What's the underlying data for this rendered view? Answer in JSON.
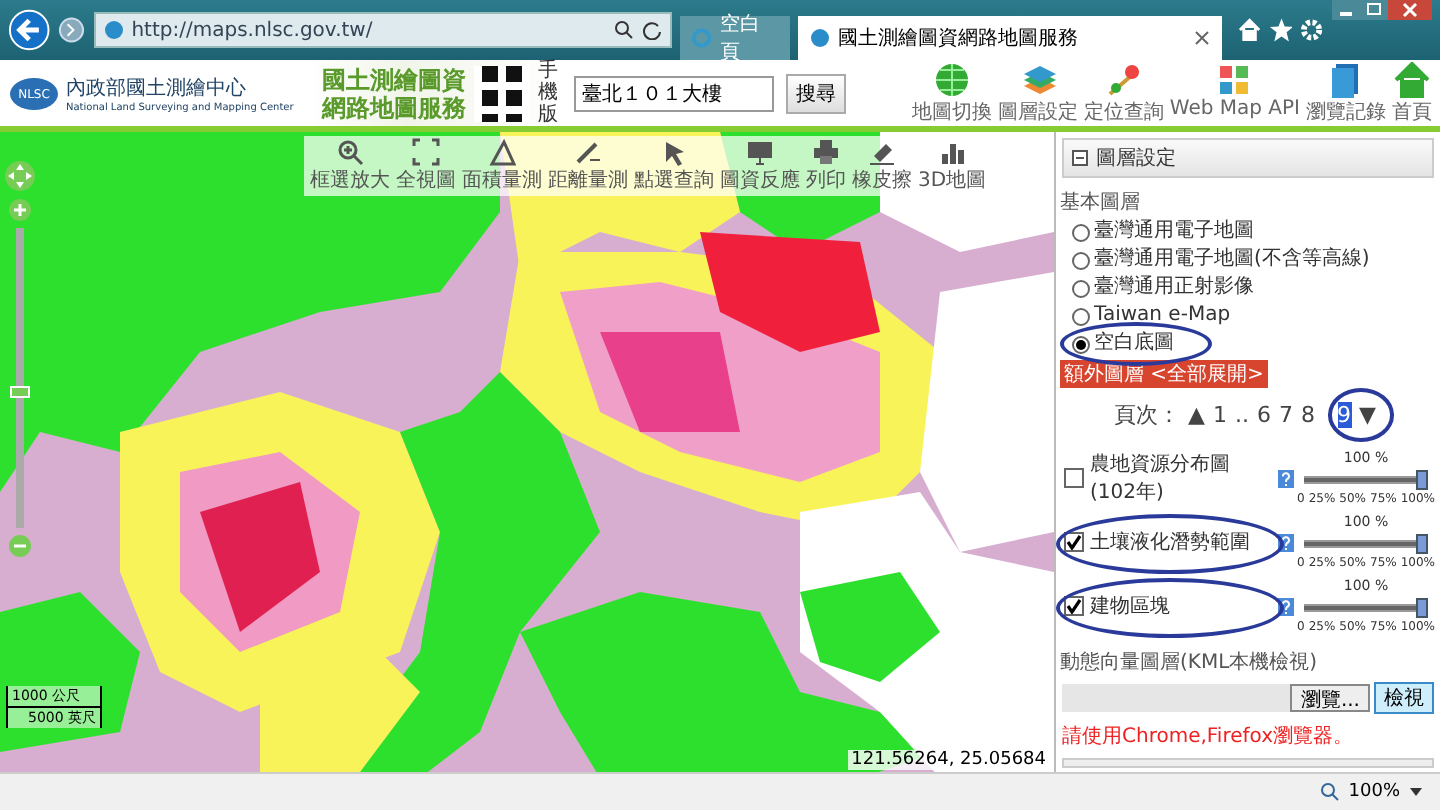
{
  "browser": {
    "address": "http://maps.nlsc.gov.tw/",
    "tabs": [
      {
        "label": "空白頁",
        "selected": false
      },
      {
        "label": "國土測繪圖資網路地圖服務",
        "selected": true
      }
    ]
  },
  "header": {
    "org_name": "內政部國土測繪中心",
    "org_name_en": "National Land Surveying and Mapping Center",
    "logo_text": "NLSC",
    "site_title": [
      "國土測繪圖資",
      "網路地圖服務"
    ],
    "mobile_label": "手機版",
    "search": {
      "value": "臺北１０１大樓"
    },
    "search_button": "搜尋",
    "nav": [
      {
        "label": "地圖切換",
        "kind": "globe"
      },
      {
        "label": "圖層設定",
        "kind": "layers"
      },
      {
        "label": "定位查詢",
        "kind": "pin"
      },
      {
        "label": "Web Map API",
        "kind": "api"
      },
      {
        "label": "瀏覽記錄",
        "kind": "record"
      },
      {
        "label": "首頁",
        "kind": "home"
      }
    ]
  },
  "map": {
    "toolbar": [
      {
        "label": "框選放大",
        "kind": "zoom"
      },
      {
        "label": "全視圖",
        "kind": "full"
      },
      {
        "label": "面積量測",
        "kind": "area"
      },
      {
        "label": "距離量測",
        "kind": "distance"
      },
      {
        "label": "點選查詢",
        "kind": "query"
      },
      {
        "label": "圖資反應",
        "kind": "feedback"
      },
      {
        "label": "列印",
        "kind": "print"
      },
      {
        "label": "橡皮擦",
        "kind": "eraser"
      },
      {
        "label": "3D地圖",
        "kind": "threed"
      }
    ],
    "zoom_slider": {
      "level": 0.45
    },
    "scale": [
      "1000 公尺",
      "5000 英尺"
    ],
    "coordinates": "121.56264, 25.05684"
  },
  "panel": {
    "title": "圖層設定",
    "base_title": "基本圖層",
    "base_layers": [
      {
        "label": "臺灣通用電子地圖",
        "selected": false,
        "circled": false
      },
      {
        "label": "臺灣通用電子地圖(不含等高線)",
        "selected": false,
        "circled": false
      },
      {
        "label": "臺灣通用正射影像",
        "selected": false,
        "circled": false
      },
      {
        "label": "Taiwan e-Map",
        "selected": false,
        "circled": false
      },
      {
        "label": "空白底圖",
        "selected": true,
        "circled": true
      }
    ],
    "extra_title": "額外圖層 <全部展開>",
    "pagination": {
      "label": "頁次：",
      "prev": "▲",
      "next": "▼",
      "circled": true,
      "pages": [
        {
          "label": "1",
          "selected": false
        },
        {
          "label": "..",
          "selected": false
        },
        {
          "label": "6",
          "selected": false
        },
        {
          "label": "7",
          "selected": false
        },
        {
          "label": "8",
          "selected": false
        },
        {
          "label": "9",
          "selected": true
        }
      ]
    },
    "layers": [
      {
        "name": "農地資源分布圖(102年)",
        "checked": false,
        "circled": false,
        "level": 1,
        "reading": "100 %",
        "ticks": [
          "0",
          "25%",
          "50%",
          "75%",
          "100%"
        ]
      },
      {
        "name": "土壤液化潛勢範圍",
        "checked": true,
        "circled": true,
        "level": 1,
        "reading": "100 %",
        "ticks": [
          "0",
          "25%",
          "50%",
          "75%",
          "100%"
        ]
      },
      {
        "name": "建物區塊",
        "checked": true,
        "circled": true,
        "level": 1,
        "reading": "100 %",
        "ticks": [
          "0",
          "25%",
          "50%",
          "75%",
          "100%"
        ]
      }
    ],
    "kml_title": "動態向量圖層(KML本機檢視)",
    "browse_button": "瀏覽...",
    "view_button": "檢視",
    "notice": "請使用Chrome,Firefox瀏覽器。"
  },
  "status_bar": {
    "zoom": "100%"
  }
}
